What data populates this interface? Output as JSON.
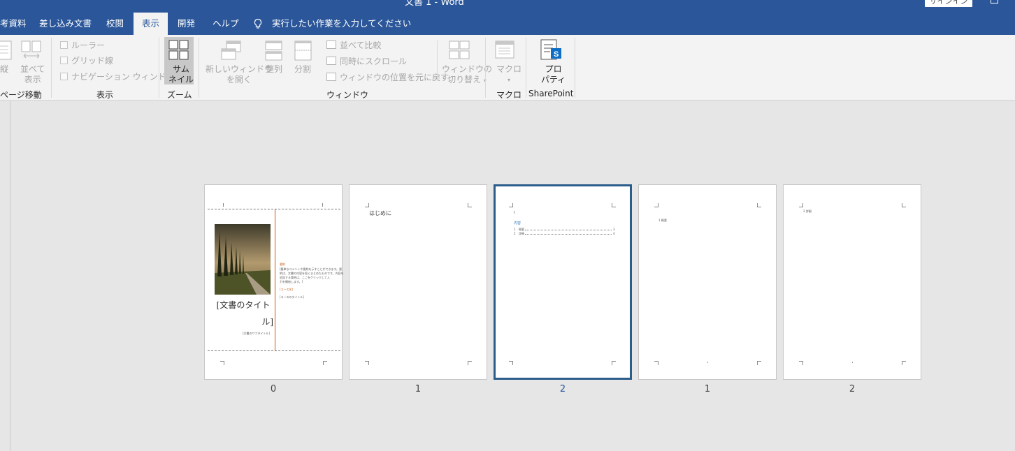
{
  "window": {
    "title": "文書 1 - Word",
    "signin_label": "サインイン"
  },
  "tabs": [
    {
      "label": "考資料",
      "active": false
    },
    {
      "label": "差し込み文書",
      "active": false
    },
    {
      "label": "校閲",
      "active": false
    },
    {
      "label": "表示",
      "active": true
    },
    {
      "label": "開発",
      "active": false
    },
    {
      "label": "ヘルプ",
      "active": false
    }
  ],
  "tell_me": {
    "text": "実行したい作業を入力してください",
    "icon": "lightbulb-icon"
  },
  "ribbon": {
    "page_movement": {
      "vertical_label": "縦",
      "side_by_side_label": [
        "並べて",
        "表示"
      ],
      "group_label": "ページ移動"
    },
    "show": {
      "ruler_label": "ルーラー",
      "gridlines_label": "グリッド線",
      "nav_pane_label": "ナビゲーション ウィンドウ",
      "group_label": "表示"
    },
    "zoom": {
      "thumbnail_label": [
        "サム",
        "ネイル"
      ],
      "group_label": "ズーム"
    },
    "window": {
      "new_window_label": [
        "新しいウィンドウ",
        "を開く"
      ],
      "arrange_label": "整列",
      "split_label": "分割",
      "compare_label": "並べて比較",
      "sync_scroll_label": "同時にスクロール",
      "reset_position_label": "ウィンドウの位置を元に戻す",
      "switch_window_label": [
        "ウィンドウの",
        "切り替え"
      ],
      "group_label": "ウィンドウ"
    },
    "macro": {
      "macro_label": "マクロ",
      "group_label": "マクロ"
    },
    "sharepoint": {
      "properties_label": [
        "プロ",
        "パティ"
      ],
      "group_label": "SharePoint"
    }
  },
  "pages": [
    {
      "number": "0",
      "selected": false,
      "cover_title_line1": "[文書のタイト",
      "cover_title_line2": "ル]",
      "cover_subtitle": "[文書のサブタイトル]",
      "abstract_heading": "要約",
      "abstract_lines": [
        "[簡単なコメントや要約を示すことができます。要",
        "約は、文書の内容を短くまとめたものです。内容を",
        "追加する場合は、ここをクリックして入",
        "力を開始します。]"
      ],
      "course_heading": "[コース名]",
      "course_value": "[コースのタイトル]"
    },
    {
      "number": "1",
      "selected": false,
      "heading": "はじめに"
    },
    {
      "number": "2",
      "selected": true,
      "toc_heading": "内容",
      "toc_entries": [
        {
          "num": "1",
          "title": "概要",
          "page": "3"
        },
        {
          "num": "2",
          "title": "詳細",
          "page": "4"
        }
      ]
    },
    {
      "number": "1",
      "selected": false,
      "heading": "1 概要"
    },
    {
      "number": "2",
      "selected": false,
      "heading": "2 詳細"
    }
  ],
  "colors": {
    "accent": "#2b579a",
    "selected_page_border": "#2b5d8a",
    "cover_orange": "#c55a11"
  }
}
